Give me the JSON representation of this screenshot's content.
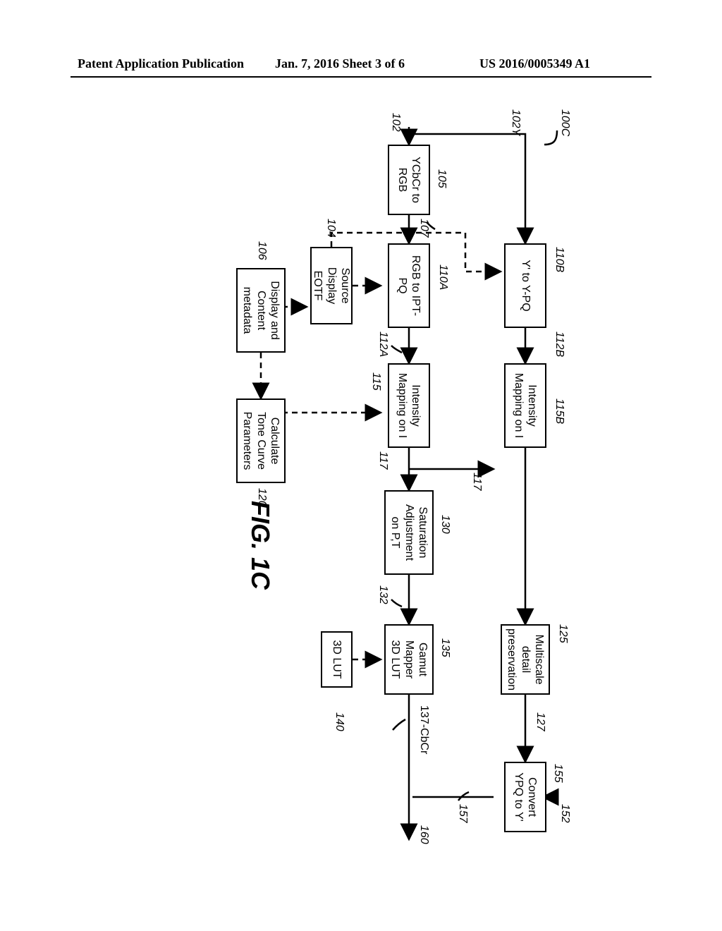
{
  "header": {
    "left": "Patent Application Publication",
    "center": "Jan. 7, 2016   Sheet 3 of 6",
    "right": "US 2016/0005349 A1"
  },
  "figure_label": "FIG. 1C",
  "labels": {
    "l100c": "100C",
    "l102": "102",
    "l102y": "102Y",
    "l104": "104",
    "l105": "105",
    "l106": "106",
    "l107": "107",
    "l110a": "110A",
    "l110b": "110B",
    "l112a": "112A",
    "l112b": "112B",
    "l115": "115",
    "l115b": "115B",
    "l117a": "117",
    "l117b": "117",
    "l120": "120",
    "l125": "125",
    "l127": "127",
    "l130": "130",
    "l132": "132",
    "l135": "135",
    "l137": "137-CbCr",
    "l140": "140",
    "l152": "152",
    "l155": "155",
    "l157": "157",
    "l160": "160"
  },
  "boxes": {
    "ycbcr": "YCbCr to\nRGB",
    "rgb_ipt": "RGB to IPT-\nPQ",
    "y_ypq": "Y' to Y-PQ",
    "src_eotf": "Source\nDisplay EOTF",
    "disp_meta": "Display and\nContent\nmetadata",
    "calc_tone": "Calculate\nTone Curve\nParameters",
    "imap_a": "Intensity\nMapping on I",
    "imap_b": "Intensity\nMapping on I",
    "sat_adj": "Saturation\nAdjustment\non P,T",
    "multiscale": "Multiscale\ndetail\npreservation",
    "gamut": "Gamut\nMapper\n3D LUT",
    "lut3d": "3D LUT",
    "convert": "Convert\nYPQ to Y'"
  }
}
